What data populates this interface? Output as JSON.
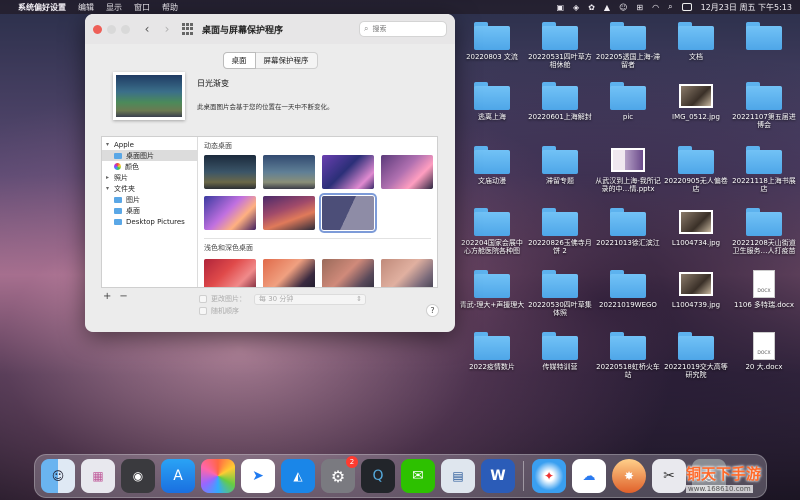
{
  "menubar": {
    "app_name": "系统偏好设置",
    "menus": [
      "编辑",
      "显示",
      "窗口",
      "帮助"
    ],
    "clock": "12月23日 周五 下午5:13"
  },
  "window": {
    "title": "桌面与屏幕保护程序",
    "search_placeholder": "搜索",
    "tabs": [
      {
        "label": "桌面",
        "active": true
      },
      {
        "label": "屏幕保护程序",
        "active": false
      }
    ],
    "preview": {
      "name": "日光渐变",
      "description": "此桌面图片会基于您的位置在一天中不断变化。"
    },
    "sidebar": [
      {
        "label": "Apple",
        "level": 0,
        "expanded": true
      },
      {
        "label": "桌面图片",
        "level": 1,
        "selected": true
      },
      {
        "label": "颜色",
        "level": 1
      },
      {
        "label": "照片",
        "level": 0,
        "expanded": false
      },
      {
        "label": "文件夹",
        "level": 0,
        "expanded": true
      },
      {
        "label": "图片",
        "level": 1
      },
      {
        "label": "桌面",
        "level": 1
      },
      {
        "label": "Desktop Pictures",
        "level": 1
      }
    ],
    "sections": [
      {
        "title": "动态桌面"
      },
      {
        "title": "浅色和深色桌面"
      }
    ],
    "add_label": "+",
    "remove_label": "−",
    "change_picture_label": "更改图片：",
    "change_interval": "每 30 分钟",
    "random_order_label": "随机顺序",
    "help_label": "?"
  },
  "desktop_items": [
    {
      "label": "20220803 文流",
      "kind": "folder"
    },
    {
      "label": "20220531四叶草方相休舱",
      "kind": "folder"
    },
    {
      "label": "202205透国上海-滞留者",
      "kind": "folder"
    },
    {
      "label": "文档",
      "kind": "folder"
    },
    {
      "label": "",
      "kind": "folder"
    },
    {
      "label": "逃离上海",
      "kind": "folder"
    },
    {
      "label": "20220601上海解封",
      "kind": "folder"
    },
    {
      "label": "pic",
      "kind": "folder"
    },
    {
      "label": "IMG_0512.jpg",
      "kind": "image"
    },
    {
      "label": "20221107第五届进博会",
      "kind": "folder"
    },
    {
      "label": "文庙动漫",
      "kind": "folder"
    },
    {
      "label": "滞留专题",
      "kind": "folder"
    },
    {
      "label": "从武汉到上海-我所记录的中…情.pptx",
      "kind": "pptx"
    },
    {
      "label": "20220905无人偏卷店",
      "kind": "folder"
    },
    {
      "label": "20221118上海书展店",
      "kind": "folder"
    },
    {
      "label": "202204国家会展中心方舱医院各种图",
      "kind": "folder"
    },
    {
      "label": "20220826玉佛寺月饼 2",
      "kind": "folder"
    },
    {
      "label": "20221013徐汇滨江",
      "kind": "folder"
    },
    {
      "label": "L1004734.jpg",
      "kind": "image"
    },
    {
      "label": "20221208天山街道卫生服务…人打疫苗",
      "kind": "folder"
    },
    {
      "label": "青武-理大+声援理大",
      "kind": "folder"
    },
    {
      "label": "20220530四叶草集体照",
      "kind": "folder"
    },
    {
      "label": "20221019WEGO",
      "kind": "folder"
    },
    {
      "label": "L1004739.jpg",
      "kind": "image"
    },
    {
      "label": "1106 多特瑞.docx",
      "kind": "docx"
    },
    {
      "label": "2022疫情数片",
      "kind": "folder"
    },
    {
      "label": "传媒特训营",
      "kind": "folder"
    },
    {
      "label": "20220518虹桥火车站",
      "kind": "folder"
    },
    {
      "label": "20221019交大高等研究院",
      "kind": "folder"
    },
    {
      "label": "20 大.docx",
      "kind": "docx"
    }
  ],
  "doc_file_tag": "DOCX",
  "dock": {
    "apps": [
      "finder",
      "launchpad",
      "screenshot",
      "app-store",
      "photos",
      "feishu",
      "lanhu",
      "system-preferences",
      "quicktime",
      "wechat",
      "preview",
      "word",
      "safari",
      "baidu-netdisk",
      "xmind",
      "scissors",
      "coins"
    ],
    "sysprefs_badge": "2"
  },
  "watermark": {
    "title": "铜天下手游",
    "url": "www.168610.com"
  }
}
